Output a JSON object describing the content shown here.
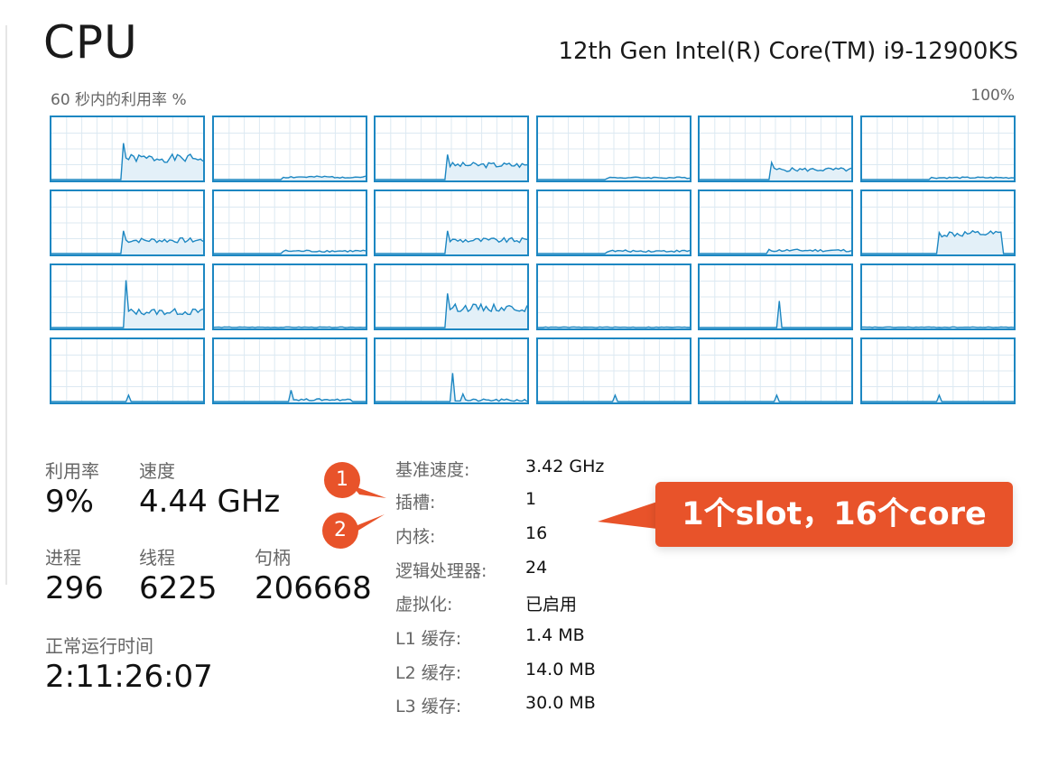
{
  "header": {
    "title": "CPU",
    "model": "12th Gen Intel(R) Core(TM) i9-12900KS",
    "graph_label": "60 秒内的利用率 %",
    "graph_max": "100%"
  },
  "stats": {
    "utilization_label": "利用率",
    "utilization_value": "9%",
    "speed_label": "速度",
    "speed_value": "4.44 GHz",
    "processes_label": "进程",
    "processes_value": "296",
    "threads_label": "线程",
    "threads_value": "6225",
    "handles_label": "句柄",
    "handles_value": "206668",
    "uptime_label": "正常运行时间",
    "uptime_value": "2:11:26:07"
  },
  "info": [
    {
      "label": "基准速度:",
      "value": "3.42 GHz"
    },
    {
      "label": "插槽:",
      "value": "1"
    },
    {
      "label": "内核:",
      "value": "16"
    },
    {
      "label": "逻辑处理器:",
      "value": "24"
    },
    {
      "label": "虚拟化:",
      "value": "已启用"
    },
    {
      "label": "L1 缓存:",
      "value": "1.4 MB"
    },
    {
      "label": "L2 缓存:",
      "value": "14.0 MB"
    },
    {
      "label": "L3 缓存:",
      "value": "30.0 MB"
    }
  ],
  "annotations": {
    "badge_1": "1",
    "badge_2": "2",
    "callout": "1个slot，16个core"
  },
  "graph_colors": {
    "border": "#1d87c2",
    "line": "#1d87c2",
    "fill": "#e3f0f8",
    "grid": "#dce9f2"
  },
  "core_graphs": [
    {
      "pattern": "high",
      "level": 0.32
    },
    {
      "pattern": "low",
      "level": 0.04
    },
    {
      "pattern": "mid",
      "level": 0.22
    },
    {
      "pattern": "low",
      "level": 0.03
    },
    {
      "pattern": "mid",
      "level": 0.15
    },
    {
      "pattern": "low",
      "level": 0.03
    },
    {
      "pattern": "mid",
      "level": 0.2
    },
    {
      "pattern": "low",
      "level": 0.04
    },
    {
      "pattern": "mid",
      "level": 0.2
    },
    {
      "pattern": "low",
      "level": 0.04
    },
    {
      "pattern": "low",
      "level": 0.05
    },
    {
      "pattern": "plateau",
      "level": 0.3
    },
    {
      "pattern": "spike-high",
      "level": 0.25
    },
    {
      "pattern": "flat",
      "level": 0.02
    },
    {
      "pattern": "mid",
      "level": 0.3
    },
    {
      "pattern": "flat",
      "level": 0.02
    },
    {
      "pattern": "spike",
      "level": 0.02
    },
    {
      "pattern": "flat",
      "level": 0.02
    },
    {
      "pattern": "tiny",
      "level": 0.02
    },
    {
      "pattern": "small-bump",
      "level": 0.03
    },
    {
      "pattern": "spike-mid",
      "level": 0.04
    },
    {
      "pattern": "tiny",
      "level": 0.02
    },
    {
      "pattern": "tiny",
      "level": 0.02
    },
    {
      "pattern": "tiny",
      "level": 0.02
    }
  ]
}
